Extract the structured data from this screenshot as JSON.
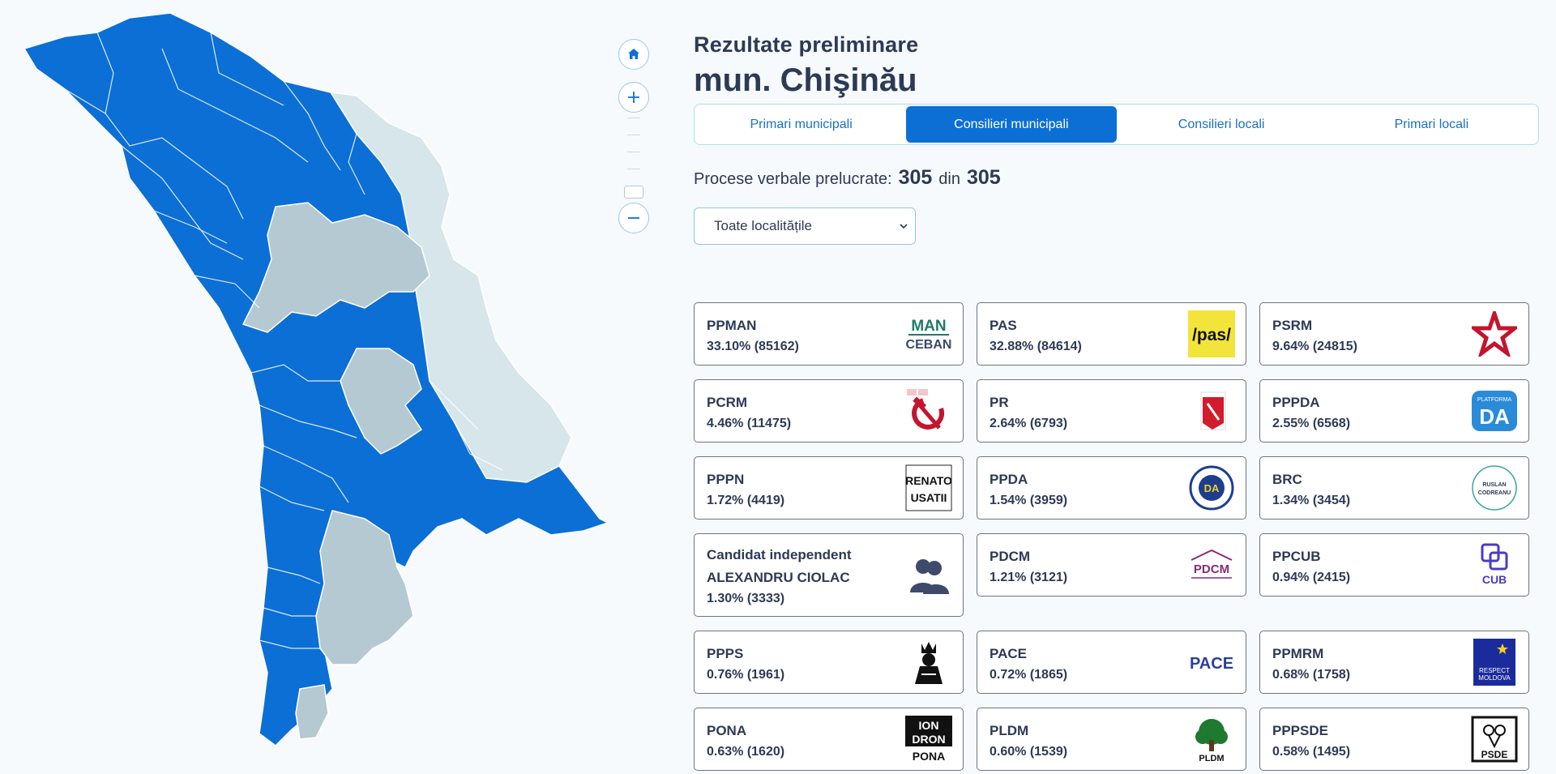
{
  "header": {
    "subtitle": "Rezultate preliminare",
    "title": "mun. Chişinău"
  },
  "tabs": [
    {
      "label": "Primari municipali",
      "active": false
    },
    {
      "label": "Consilieri municipali",
      "active": true
    },
    {
      "label": "Consilieri locali",
      "active": false
    },
    {
      "label": "Primari locali",
      "active": false
    }
  ],
  "processed": {
    "label": "Procese verbale prelucrate:",
    "done": "305",
    "sep": "din",
    "total": "305"
  },
  "filter": {
    "selected": "Toate localitățile"
  },
  "map": {
    "won_color": "#0b6fd6",
    "other_color": "#b5c9d2",
    "transnistria_color": "#d6e6ea"
  },
  "map_controls": {
    "home": "home-icon",
    "zoom_in": "plus-icon",
    "zoom_out": "minus-icon"
  },
  "parties": [
    {
      "name": "PPMAN",
      "result": "33.10% (85162)",
      "logo": "man-ceban-logo",
      "logo_text": [
        "MAN",
        "CEBAN"
      ]
    },
    {
      "name": "PAS",
      "result": "32.88% (84614)",
      "logo": "pas-logo",
      "logo_text": [
        "/pas/"
      ]
    },
    {
      "name": "PSRM",
      "result": "9.64% (24815)",
      "logo": "psrm-star-logo",
      "logo_text": []
    },
    {
      "name": "PCRM",
      "result": "4.46% (11475)",
      "logo": "hammer-sickle-logo",
      "logo_text": []
    },
    {
      "name": "PR",
      "result": "2.64% (6793)",
      "logo": "pr-logo",
      "logo_text": []
    },
    {
      "name": "PPPDA",
      "result": "2.55% (6568)",
      "logo": "platforma-da-logo",
      "logo_text": [
        "PLATFORMA",
        "DA"
      ]
    },
    {
      "name": "PPPN",
      "result": "1.72% (4419)",
      "logo": "renato-usatii-logo",
      "logo_text": [
        "RENATO",
        "USATII"
      ]
    },
    {
      "name": "PPDA",
      "result": "1.54% (3959)",
      "logo": "ppda-logo",
      "logo_text": [
        "DA"
      ]
    },
    {
      "name": "BRC",
      "result": "1.34% (3454)",
      "logo": "ruslan-codreanu-logo",
      "logo_text": [
        "RUSLAN",
        "CODREANU"
      ]
    },
    {
      "name": "Candidat independent ALEXANDRU CIOLAC",
      "result": "1.30% (3333)",
      "logo": "people-icon",
      "logo_text": []
    },
    {
      "name": "PDCM",
      "result": "1.21% (3121)",
      "logo": "pdcm-logo",
      "logo_text": [
        "PDCM"
      ]
    },
    {
      "name": "PPCUB",
      "result": "0.94% (2415)",
      "logo": "cub-logo",
      "logo_text": [
        "CUB"
      ]
    },
    {
      "name": "PPPS",
      "result": "0.76% (1961)",
      "logo": "ppps-logo",
      "logo_text": []
    },
    {
      "name": "PACE",
      "result": "0.72% (1865)",
      "logo": "pace-logo",
      "logo_text": [
        "PACE"
      ]
    },
    {
      "name": "PPMRM",
      "result": "0.68% (1758)",
      "logo": "respect-moldova-logo",
      "logo_text": [
        "RESPECT",
        "MOLDOVA"
      ]
    },
    {
      "name": "PONA",
      "result": "0.63% (1620)",
      "logo": "ion-dron-logo",
      "logo_text": [
        "ION",
        "DRON",
        "PONA"
      ]
    },
    {
      "name": "PLDM",
      "result": "0.60% (1539)",
      "logo": "pldm-tree-logo",
      "logo_text": [
        "PLDM"
      ]
    },
    {
      "name": "PPPSDE",
      "result": "0.58% (1495)",
      "logo": "psde-logo",
      "logo_text": [
        "PSDE"
      ]
    }
  ]
}
